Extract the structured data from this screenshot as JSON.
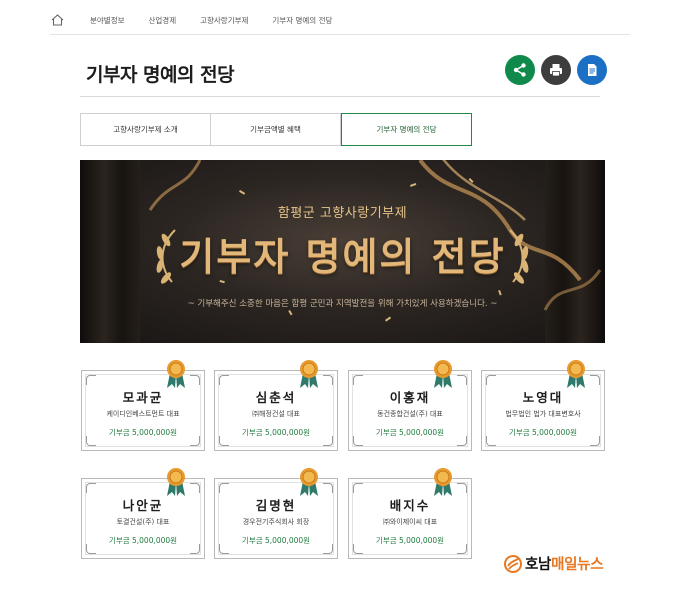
{
  "breadcrumb": {
    "items": [
      "분야별정보",
      "산업경제",
      "고향사랑기부제",
      "기부자 명예의 전당"
    ]
  },
  "page": {
    "title": "기부자 명예의 전당"
  },
  "actions": [
    {
      "name": "share-icon",
      "color": "#0f8a4a"
    },
    {
      "name": "print-icon",
      "color": "#3d3d3d"
    },
    {
      "name": "document-icon",
      "color": "#1b6fc5"
    }
  ],
  "tabs": [
    {
      "label": "고향사랑기부제 소개",
      "active": false
    },
    {
      "label": "기부금액별 혜택",
      "active": false
    },
    {
      "label": "기부자 명예의 전당",
      "active": true
    }
  ],
  "banner": {
    "subtitle": "함평군 고향사랑기부제",
    "title": "기부자 명예의 전당",
    "description": "~ 기부해주신 소중한 마음은 함평 군민과 지역발전을 위해 가치있게 사용하겠습니다. ~"
  },
  "donors": [
    {
      "name": "모과균",
      "org": "케이디인베스트먼트 대표",
      "amount": "기부금 5,000,000원"
    },
    {
      "name": "심춘석",
      "org": "㈜해정건설 대표",
      "amount": "기부금 5,000,000원"
    },
    {
      "name": "이홍재",
      "org": "동건종합건설(주) 대표",
      "amount": "기부금 5,000,000원"
    },
    {
      "name": "노영대",
      "org": "법무법인 법가 대표변호사",
      "amount": "기부금 5,000,000원"
    },
    {
      "name": "나안균",
      "org": "토결건설(주) 대표",
      "amount": "기부금 5,000,000원"
    },
    {
      "name": "김명현",
      "org": "경우전기주식회사 회장",
      "amount": "기부금 5,000,000원"
    },
    {
      "name": "배지수",
      "org": "㈜와이제이씨 대표",
      "amount": "기부금 5,000,000원"
    }
  ],
  "watermark": {
    "brand_part1": "호남",
    "brand_part2": "매일뉴스"
  },
  "colors": {
    "accent_green": "#1f8a46",
    "amount_green": "#1f7a3e",
    "banner_gold": "#e2b779",
    "brand_orange": "#e8771f"
  }
}
